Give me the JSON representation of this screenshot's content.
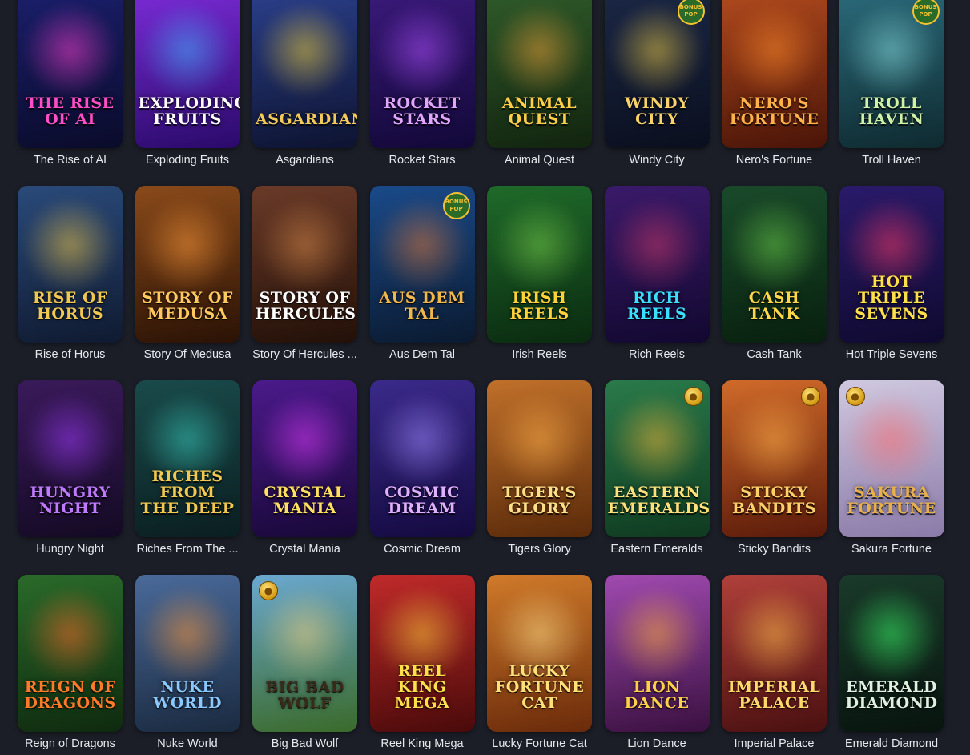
{
  "games": [
    {
      "title": "The Rise of AI",
      "logo": "The Rise of AI",
      "bg1": "#1a1f6b",
      "bg2": "#0a0b2a",
      "glow": "#ff3fd0",
      "logo_color": "#ff4fc8"
    },
    {
      "title": "Exploding Fruits",
      "logo": "Exploding Fruits",
      "bg1": "#7a2bd6",
      "bg2": "#2a0a6a",
      "glow": "#3fb6ff",
      "logo_color": "#ffffff"
    },
    {
      "title": "Asgardians",
      "logo": "Asgardians",
      "bg1": "#2b3f8a",
      "bg2": "#0d1330",
      "glow": "#f3d33a",
      "logo_color": "#f2c95a"
    },
    {
      "title": "Rocket Stars",
      "logo": "Rocket Stars",
      "bg1": "#3a1a7a",
      "bg2": "#120838",
      "glow": "#b04fff",
      "logo_color": "#e2a6ff"
    },
    {
      "title": "Animal Quest",
      "logo": "Animal Quest",
      "bg1": "#2f5a2a",
      "bg2": "#12240f",
      "glow": "#f0a23a",
      "logo_color": "#ffcf4a"
    },
    {
      "title": "Windy City",
      "logo": "Windy City",
      "bg1": "#1b2746",
      "bg2": "#0a0f1e",
      "glow": "#f2d04a",
      "logo_color": "#f7d36a",
      "badge": "BONUS POP"
    },
    {
      "title": "Nero's Fortune",
      "logo": "Nero's Fortune",
      "bg1": "#b04a1e",
      "bg2": "#4a1408",
      "glow": "#ff8a2a",
      "logo_color": "#ffb24a"
    },
    {
      "title": "Troll Haven",
      "logo": "Troll Haven",
      "bg1": "#2a6a7a",
      "bg2": "#0f2a30",
      "glow": "#8adfe0",
      "logo_color": "#cff2a8",
      "badge": "BONUS POP"
    },
    {
      "title": "Rise of Horus",
      "logo": "Rise of Horus",
      "bg1": "#2a4a7a",
      "bg2": "#0f1a30",
      "glow": "#f2c84a",
      "logo_color": "#f0c850"
    },
    {
      "title": "Story Of Medusa",
      "logo": "Story of Medusa",
      "bg1": "#8a4a1a",
      "bg2": "#2a1205",
      "glow": "#ff9a3a",
      "logo_color": "#ffc860"
    },
    {
      "title": "Story Of Hercules ...",
      "logo": "Story of Hercules",
      "bg1": "#6a3a28",
      "bg2": "#221008",
      "glow": "#d88a4a",
      "logo_color": "#ffffff"
    },
    {
      "title": "Aus Dem Tal",
      "logo": "Aus Dem Tal",
      "bg1": "#1a4a8a",
      "bg2": "#0a1a30",
      "glow": "#e07a3a",
      "logo_color": "#f2b74a",
      "badge": "BONUS POP"
    },
    {
      "title": "Irish Reels",
      "logo": "Irish Reels",
      "bg1": "#1f6a2a",
      "bg2": "#0a2a10",
      "glow": "#7ad04a",
      "logo_color": "#ffd23a"
    },
    {
      "title": "Rich Reels",
      "logo": "Rich Reels",
      "bg1": "#3a1a6a",
      "bg2": "#120830",
      "glow": "#d03a6a",
      "logo_color": "#3ae0ff"
    },
    {
      "title": "Cash Tank",
      "logo": "Cash Tank",
      "bg1": "#1a4a2a",
      "bg2": "#08200f",
      "glow": "#6ad04a",
      "logo_color": "#ffd84a"
    },
    {
      "title": "Hot Triple Sevens",
      "logo": "Hot Triple Sevens",
      "bg1": "#2a1a6a",
      "bg2": "#0f0a30",
      "glow": "#ff3a6a",
      "logo_color": "#ffe04a"
    },
    {
      "title": "Hungry Night",
      "logo": "Hungry Night",
      "bg1": "#3a1a5a",
      "bg2": "#140a24",
      "glow": "#a03aff",
      "logo_color": "#c07aff"
    },
    {
      "title": "Riches From The ...",
      "logo": "Riches from the Deep",
      "bg1": "#1a4a4a",
      "bg2": "#0a1e20",
      "glow": "#3ad0c0",
      "logo_color": "#f2c850"
    },
    {
      "title": "Crystal Mania",
      "logo": "Crystal Mania",
      "bg1": "#4a1a8a",
      "bg2": "#180838",
      "glow": "#e03aff",
      "logo_color": "#ffe060"
    },
    {
      "title": "Cosmic Dream",
      "logo": "Cosmic Dream",
      "bg1": "#3a2a8a",
      "bg2": "#140a40",
      "glow": "#a08aff",
      "logo_color": "#e0b0ff"
    },
    {
      "title": "Tigers Glory",
      "logo": "Tiger's Glory",
      "bg1": "#c0702a",
      "bg2": "#5a2a0a",
      "glow": "#ffb04a",
      "logo_color": "#ffe08a"
    },
    {
      "title": "Eastern Emeralds",
      "logo": "Eastern Emeralds",
      "bg1": "#2a7a4a",
      "bg2": "#0f3a20",
      "glow": "#f0b83a",
      "logo_color": "#ffe07a",
      "coin": "right"
    },
    {
      "title": "Sticky Bandits",
      "logo": "Sticky Bandits",
      "bg1": "#d06a2a",
      "bg2": "#5a1a0a",
      "glow": "#ffb04a",
      "logo_color": "#ffd06a",
      "coin": "right"
    },
    {
      "title": "Sakura Fortune",
      "logo": "Sakura Fortune",
      "bg1": "#d0c8e0",
      "bg2": "#8a7aa8",
      "glow": "#ff6a6a",
      "logo_color": "#e8b04a",
      "coin": "left"
    },
    {
      "title": "Reign of Dragons",
      "logo": "Reign of Dragons",
      "bg1": "#2a6a2a",
      "bg2": "#0f2a0f",
      "glow": "#ff6a2a",
      "logo_color": "#ff7a2a"
    },
    {
      "title": "Nuke World",
      "logo": "Nuke World",
      "bg1": "#4a6a9a",
      "bg2": "#1a2a40",
      "glow": "#ff9a3a",
      "logo_color": "#8ac8ff"
    },
    {
      "title": "Big Bad Wolf",
      "logo": "Big Bad Wolf",
      "bg1": "#6aa8d0",
      "bg2": "#3a6a2a",
      "glow": "#f0d080",
      "logo_color": "#3a2a1a",
      "coin": "left"
    },
    {
      "title": "Reel King Mega",
      "logo": "Reel King Mega",
      "bg1": "#c02a2a",
      "bg2": "#4a0a0a",
      "glow": "#ffd03a",
      "logo_color": "#ffe04a"
    },
    {
      "title": "Lucky Fortune Cat",
      "logo": "Lucky Fortune Cat",
      "bg1": "#d07a2a",
      "bg2": "#6a2a0a",
      "glow": "#ffe08a",
      "logo_color": "#ffe07a"
    },
    {
      "title": "Lion Dance",
      "logo": "Lion Dance",
      "bg1": "#a04ab0",
      "bg2": "#3a1040",
      "glow": "#ffb03a",
      "logo_color": "#ffd04a"
    },
    {
      "title": "Imperial Palace",
      "logo": "Imperial Palace",
      "bg1": "#b0403a",
      "bg2": "#4a1010",
      "glow": "#ffc04a",
      "logo_color": "#ffd86a"
    },
    {
      "title": "Emerald Diamond",
      "logo": "Emerald Diamond",
      "bg1": "#1a3a2a",
      "bg2": "#08140f",
      "glow": "#3aff6a",
      "logo_color": "#e0f0e0"
    }
  ]
}
